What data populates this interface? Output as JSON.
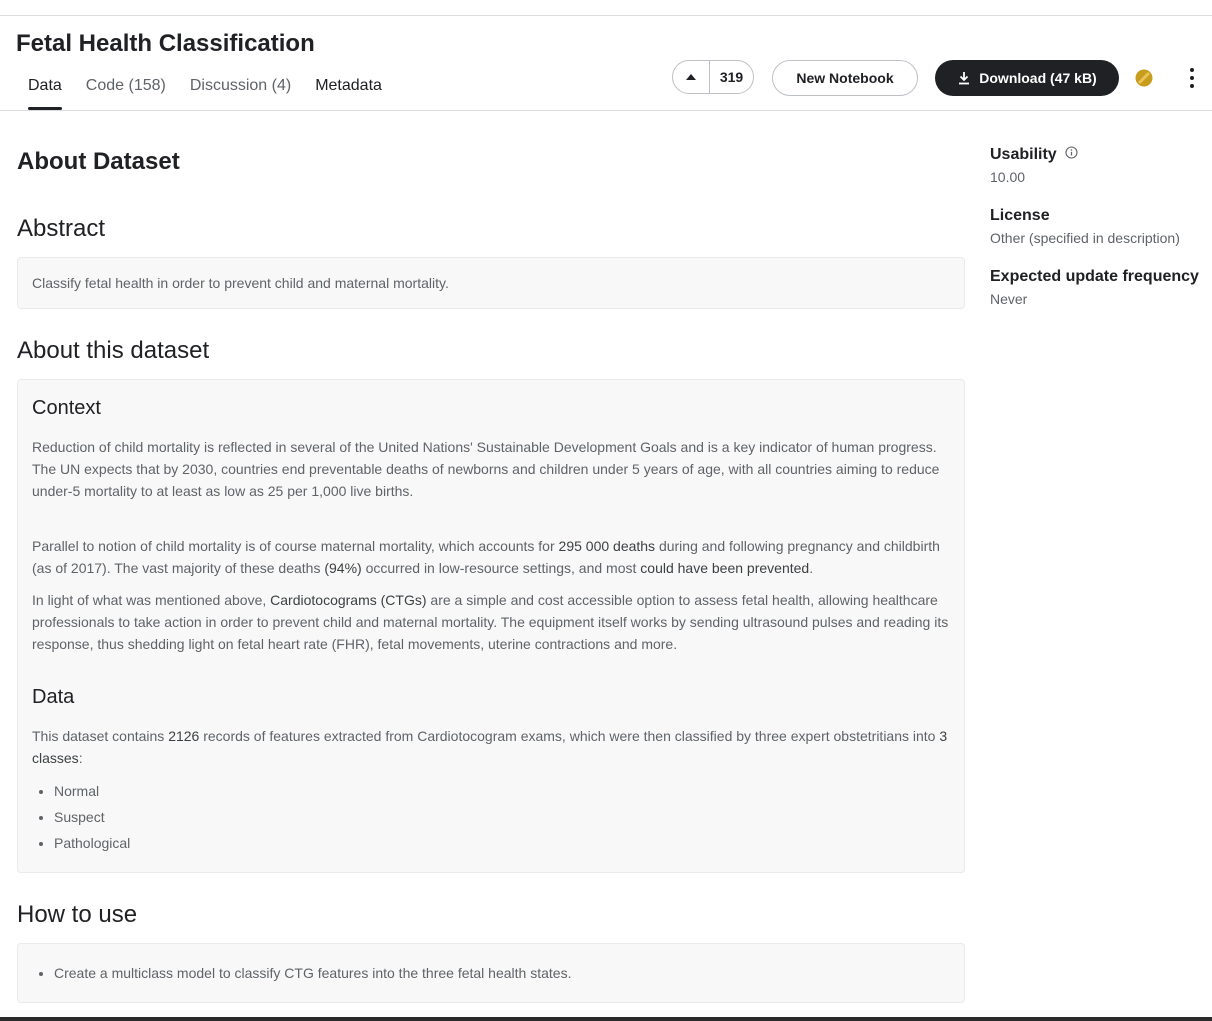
{
  "header": {
    "title": "Fetal Health Classification",
    "tabs": [
      {
        "label": "Data"
      },
      {
        "label": "Code (158)"
      },
      {
        "label": "Discussion (4)"
      },
      {
        "label": "Metadata"
      }
    ],
    "vote_count": "319",
    "new_notebook_label": "New Notebook",
    "download_label": "Download (47 kB)",
    "colors": {
      "accent_dark": "#202124",
      "medal": "#c89c1d"
    }
  },
  "main": {
    "about_heading": "About Dataset",
    "abstract_heading": "Abstract",
    "abstract_text": "Classify fetal health in order to prevent child and maternal mortality.",
    "about_this_heading": "About this dataset",
    "context_heading": "Context",
    "context_p1": "Reduction of child mortality is reflected in several of the United Nations' Sustainable Development Goals and is a key indicator of human progress.",
    "context_p1b": "The UN expects that by 2030, countries end preventable deaths of newborns and children under 5 years of age, with all countries aiming to reduce under-5 mortality to at least as low as 25 per 1,000 live births.",
    "context_p2_a": "Parallel to notion of child mortality is of course maternal mortality, which accounts for ",
    "context_p2_b": "295 000 deaths",
    "context_p2_c": " during and following pregnancy and childbirth (as of 2017). The vast majority of these deaths ",
    "context_p2_d": "(94%)",
    "context_p2_e": " occurred in low-resource settings, and most ",
    "context_p2_f": "could have been prevented",
    "context_p2_g": ".",
    "context_p3_a": "In light of what was mentioned above, ",
    "context_p3_b": "Cardiotocograms (CTGs)",
    "context_p3_c": " are a simple and cost accessible option to assess fetal health, allowing healthcare professionals to take action in order to prevent child and maternal mortality. The equipment itself works by sending ultrasound pulses and reading its response, thus shedding light on fetal heart rate (FHR), fetal movements, uterine contractions and more.",
    "data_heading": "Data",
    "data_p_a": "This dataset contains ",
    "data_p_b": "2126",
    "data_p_c": " records of features extracted from Cardiotocogram exams, which were then classified by three expert obstetritians into ",
    "data_p_d": "3 classes",
    "data_p_e": ":",
    "classes": [
      "Normal",
      "Suspect",
      "Pathological"
    ],
    "howto_heading": "How to use",
    "howto_items": [
      "Create a multiclass model to classify CTG features into the three fetal health states."
    ]
  },
  "sidebar": {
    "usability_label": "Usability",
    "usability_value": "10.00",
    "license_label": "License",
    "license_value": "Other (specified in description)",
    "frequency_label": "Expected update frequency",
    "frequency_value": "Never"
  }
}
